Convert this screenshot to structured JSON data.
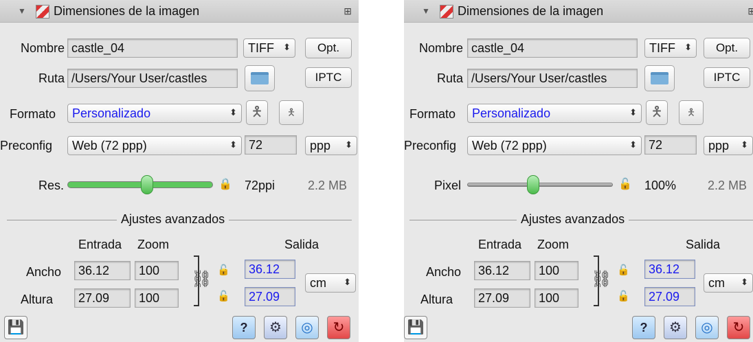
{
  "panels": [
    {
      "title": "Dimensiones de la imagen",
      "nombre_label": "Nombre",
      "nombre_value": "castle_04",
      "format_popup": "TIFF",
      "opt_button": "Opt.",
      "ruta_label": "Ruta",
      "ruta_value": "/Users/Your User/castles",
      "iptc_button": "IPTC",
      "formato_label": "Formato",
      "formato_value": "Personalizado",
      "preconfig_label": "Preconfig",
      "preconfig_value": "Web (72 ppp)",
      "res_value_field": "72",
      "unit_popup": "ppp",
      "slider_label": "Res.",
      "slider_level_fraction": 0.55,
      "slider_readout": "72ppi",
      "file_size": "2.2 MB",
      "section_title": "Ajustes avanzados",
      "col_entrada": "Entrada",
      "col_zoom": "Zoom",
      "col_salida": "Salida",
      "ancho_label": "Ancho",
      "altura_label": "Altura",
      "ancho_entrada": "36.12",
      "ancho_zoom": "100",
      "ancho_salida": "36.12",
      "altura_entrada": "27.09",
      "altura_zoom": "100",
      "altura_salida": "27.09",
      "output_unit_popup": "cm",
      "accent_color": "#5ec85e"
    },
    {
      "title": "Dimensiones de la imagen",
      "nombre_label": "Nombre",
      "nombre_value": "castle_04",
      "format_popup": "TIFF",
      "opt_button": "Opt.",
      "ruta_label": "Ruta",
      "ruta_value": "/Users/Your User/castles",
      "iptc_button": "IPTC",
      "formato_label": "Formato",
      "formato_value": "Personalizado",
      "preconfig_label": "Preconfig",
      "preconfig_value": "Web (72 ppp)",
      "res_value_field": "72",
      "unit_popup": "ppp",
      "slider_label": "Pixel",
      "slider_level_fraction": 0.45,
      "slider_readout": "100%",
      "file_size": "2.2 MB",
      "section_title": "Ajustes avanzados",
      "col_entrada": "Entrada",
      "col_zoom": "Zoom",
      "col_salida": "Salida",
      "ancho_label": "Ancho",
      "altura_label": "Altura",
      "ancho_entrada": "36.12",
      "ancho_zoom": "100",
      "ancho_salida": "36.12",
      "altura_entrada": "27.09",
      "altura_zoom": "100",
      "altura_salida": "27.09",
      "output_unit_popup": "cm",
      "accent_color": "#9a9a9a"
    }
  ],
  "icons": {
    "disclosure": "disclosure-triangle-icon",
    "app": "app-icon",
    "corner": "panel-options-icon",
    "folder": "folder-icon",
    "portrait": "portrait-icon",
    "landscape": "landscape-icon",
    "lock": "lock-icon",
    "chain": "chain-link-icon",
    "save": "save-icon",
    "help": "help-icon",
    "settings": "gear-icon",
    "preview": "preview-icon",
    "reset": "reset-icon"
  }
}
